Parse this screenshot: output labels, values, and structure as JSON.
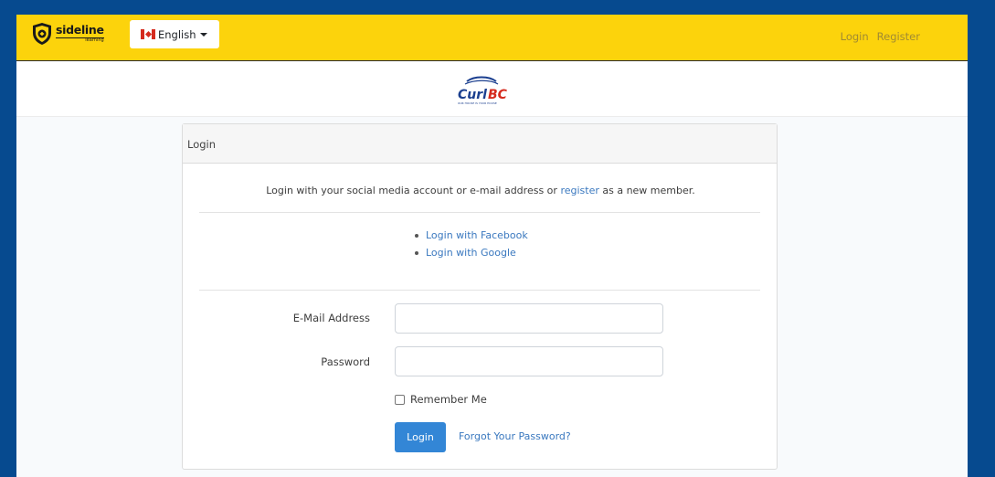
{
  "header": {
    "brand_name": "sideline",
    "brand_sub": "learning",
    "language": {
      "label": "English",
      "flag": "canada-flag-icon"
    },
    "nav": {
      "login": "Login",
      "register": "Register"
    }
  },
  "logo_band": {
    "logo_text": "Curl BC",
    "logo_tagline": "OUR HOUSE IS YOUR HOUSE"
  },
  "card": {
    "title": "Login",
    "intro_before": "Login with your social media account or e-mail address or",
    "intro_link": "register",
    "intro_after": "as a new member.",
    "social": {
      "facebook": "Login with Facebook",
      "google": "Login with Google"
    },
    "form": {
      "email_label": "E-Mail Address",
      "email_value": "",
      "password_label": "Password",
      "password_value": "",
      "remember_label": "Remember Me",
      "remember_checked": false,
      "login_button": "Login",
      "forgot_link": "Forgot Your Password?"
    }
  },
  "colors": {
    "outer_background": "#064a8f",
    "header_background": "#fcd30c",
    "link": "#3a78bf",
    "primary_button": "#3386d6",
    "nav_link": "#a08a33"
  }
}
